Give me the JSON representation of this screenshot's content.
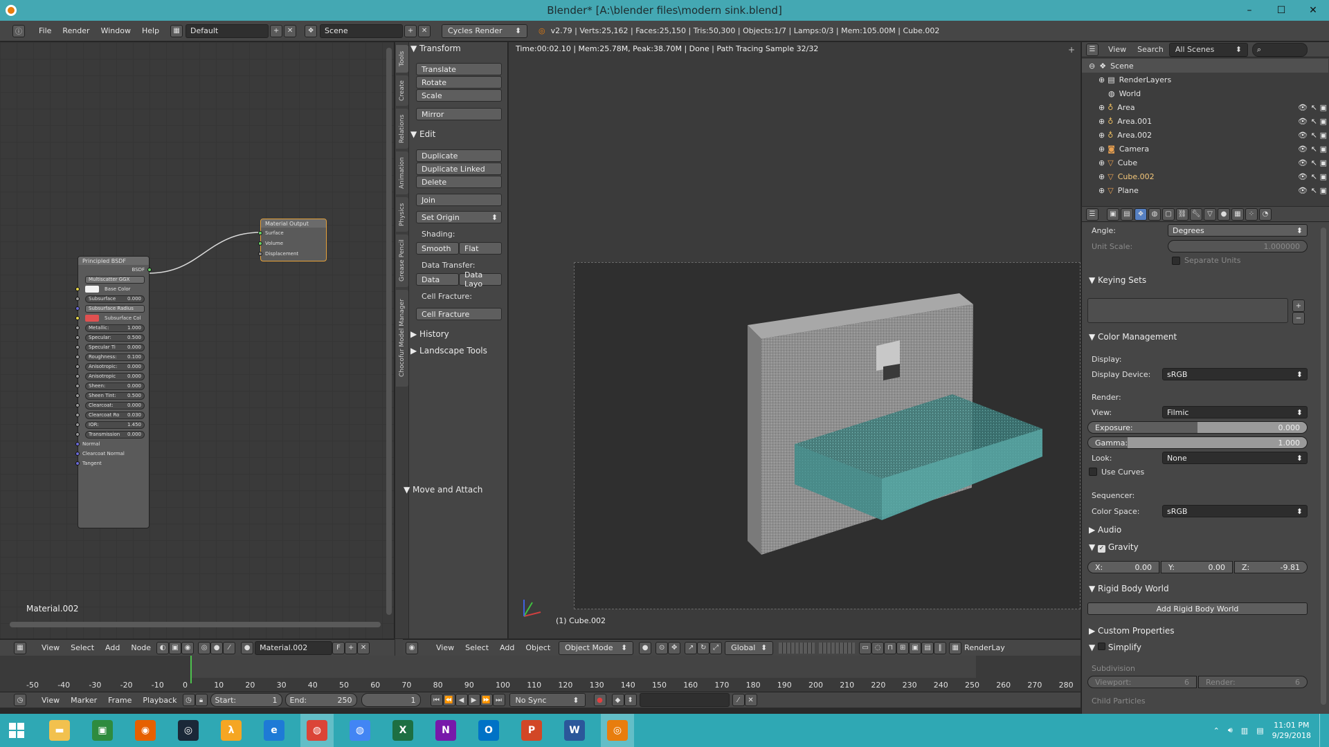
{
  "window": {
    "title": "Blender* [A:\\blender files\\modern sink.blend]",
    "controls": [
      "–",
      "☐",
      "✕"
    ]
  },
  "info_header": {
    "menus": [
      "File",
      "Render",
      "Window",
      "Help"
    ],
    "layout": "Default",
    "scene": "Scene",
    "engine": "Cycles Render",
    "stats": "v2.79 | Verts:25,162 | Faces:25,150 | Tris:50,300 | Objects:1/7 | Lamps:0/3 | Mem:105.00M | Cube.002"
  },
  "node_editor": {
    "material_label": "Material.002",
    "principled_node": {
      "title": "Principled BSDF",
      "output": "BSDF",
      "distribution": "Multiscatter GGX",
      "base_color": "Base Color",
      "subsurface": "Subsurface",
      "subsurface_value": "0.000",
      "subsurface_radius": "Subsurface Radius",
      "subsurface_color": "Subsurface Col",
      "params": [
        {
          "label": "Metallic:",
          "value": "1.000"
        },
        {
          "label": "Specular:",
          "value": "0.500"
        },
        {
          "label": "Specular Ti",
          "value": "0.000"
        },
        {
          "label": "Roughness:",
          "value": "0.100"
        },
        {
          "label": "Anisotropic:",
          "value": "0.000"
        },
        {
          "label": "Anisotropic",
          "value": "0.000"
        },
        {
          "label": "Sheen:",
          "value": "0.000"
        },
        {
          "label": "Sheen Tint:",
          "value": "0.500"
        },
        {
          "label": "Clearcoat:",
          "value": "0.000"
        },
        {
          "label": "Clearcoat Ro",
          "value": "0.030"
        },
        {
          "label": "IOR:",
          "value": "1.450"
        },
        {
          "label": "Transmission",
          "value": "0.000"
        }
      ],
      "inputs": [
        "Normal",
        "Clearcoat Normal",
        "Tangent"
      ]
    },
    "output_node": {
      "title": "Material Output",
      "inputs": [
        "Surface",
        "Volume",
        "Displacement"
      ]
    },
    "header": {
      "menus": [
        "View",
        "Select",
        "Add",
        "Node"
      ],
      "material": "Material.002",
      "fake_user": "F"
    }
  },
  "tool_shelf": {
    "tabs": [
      "Tools",
      "Create",
      "Relations",
      "Animation",
      "Physics",
      "Grease Pencil",
      "Chocofur Model Manager"
    ],
    "transform": {
      "title": "Transform",
      "buttons": [
        "Translate",
        "Rotate",
        "Scale",
        "Mirror"
      ]
    },
    "edit": {
      "title": "Edit",
      "buttons": [
        "Duplicate",
        "Duplicate Linked",
        "Delete",
        "Join"
      ],
      "set_origin": "Set Origin",
      "shading_label": "Shading:",
      "shading_buttons": [
        "Smooth",
        "Flat"
      ],
      "data_transfer_label": "Data Transfer:",
      "data_transfer_buttons": [
        "Data",
        "Data Layo"
      ],
      "cell_fracture_label": "Cell Fracture:",
      "cell_fracture_button": "Cell Fracture"
    },
    "collapsed": [
      "History",
      "Landscape Tools"
    ],
    "move_attach": "Move and Attach"
  },
  "viewport": {
    "render_status": "Time:00:02.10 | Mem:25.78M, Peak:38.70M | Done | Path Tracing Sample 32/32",
    "object_label": "(1) Cube.002",
    "header": {
      "menus": [
        "View",
        "Select",
        "Add",
        "Object"
      ],
      "mode": "Object Mode",
      "orientation": "Global",
      "render_layer": "RenderLay"
    }
  },
  "outliner": {
    "menus": [
      "View",
      "Search"
    ],
    "filter": "All Scenes",
    "items": [
      {
        "name": "Scene",
        "level": 0,
        "icon": "scene-icon"
      },
      {
        "name": "RenderLayers",
        "level": 1,
        "icon": "renderlayers-icon"
      },
      {
        "name": "World",
        "level": 1,
        "icon": "world-icon"
      },
      {
        "name": "Area",
        "level": 1,
        "icon": "lamp-icon"
      },
      {
        "name": "Area.001",
        "level": 1,
        "icon": "lamp-icon"
      },
      {
        "name": "Area.002",
        "level": 1,
        "icon": "lamp-icon"
      },
      {
        "name": "Camera",
        "level": 1,
        "icon": "camera-icon"
      },
      {
        "name": "Cube",
        "level": 1,
        "icon": "mesh-icon"
      },
      {
        "name": "Cube.002",
        "level": 1,
        "icon": "mesh-icon"
      },
      {
        "name": "Plane",
        "level": 1,
        "icon": "mesh-icon"
      }
    ]
  },
  "properties": {
    "units": {
      "angle_label": "Angle:",
      "angle_value": "Degrees",
      "unit_scale_label": "Unit Scale:",
      "unit_scale_value": "1.000000",
      "separate_units": "Separate Units"
    },
    "keying_sets": "Keying Sets",
    "color_management": {
      "title": "Color Management",
      "display_label": "Display:",
      "display_device_label": "Display Device:",
      "display_device": "sRGB",
      "render_label": "Render:",
      "view_label": "View:",
      "view": "Filmic",
      "exposure_label": "Exposure:",
      "exposure": "0.000",
      "gamma_label": "Gamma:",
      "gamma": "1.000",
      "look_label": "Look:",
      "look": "None",
      "use_curves": "Use Curves",
      "sequencer_label": "Sequencer:",
      "color_space_label": "Color Space:",
      "color_space": "sRGB"
    },
    "audio": "Audio",
    "gravity": {
      "title": "Gravity",
      "x_label": "X:",
      "x": "0.00",
      "y_label": "Y:",
      "y": "0.00",
      "z_label": "Z:",
      "z": "-9.81"
    },
    "rigid_body": {
      "title": "Rigid Body World",
      "button": "Add Rigid Body World"
    },
    "custom_props": "Custom Properties",
    "simplify": {
      "title": "Simplify",
      "subdivision_label": "Subdivision",
      "viewport_label": "Viewport:",
      "viewport": "6",
      "render_label": "Render:",
      "render": "6",
      "child_particles": "Child Particles"
    }
  },
  "timeline": {
    "ticks": [
      "-50",
      "-40",
      "-30",
      "-20",
      "-10",
      "0",
      "10",
      "20",
      "30",
      "40",
      "50",
      "60",
      "70",
      "80",
      "90",
      "100",
      "110",
      "120",
      "130",
      "140",
      "150",
      "160",
      "170",
      "180",
      "190",
      "200",
      "210",
      "220",
      "230",
      "240",
      "250",
      "260",
      "270",
      "280"
    ],
    "menus": [
      "View",
      "Marker",
      "Frame",
      "Playback"
    ],
    "start_label": "Start:",
    "start": "1",
    "end_label": "End:",
    "end": "250",
    "current": "1",
    "sync": "No Sync"
  },
  "taskbar": {
    "apps": [
      {
        "name": "file-explorer",
        "color": "#f2c14e",
        "glyph": "▬"
      },
      {
        "name": "store",
        "color": "#2e8b3e",
        "glyph": "▣"
      },
      {
        "name": "firefox",
        "color": "#e66000",
        "glyph": "◉"
      },
      {
        "name": "steam",
        "color": "#1b2838",
        "glyph": "◎"
      },
      {
        "name": "half-life",
        "color": "#f5a623",
        "glyph": "λ"
      },
      {
        "name": "edge",
        "color": "#1e7ad6",
        "glyph": "e"
      },
      {
        "name": "chrome",
        "color": "#db4437",
        "glyph": "◍"
      },
      {
        "name": "chrome-2",
        "color": "#4285f4",
        "glyph": "◍"
      },
      {
        "name": "excel",
        "color": "#1d6f42",
        "glyph": "X"
      },
      {
        "name": "onenote",
        "color": "#7719aa",
        "glyph": "N"
      },
      {
        "name": "outlook",
        "color": "#0072c6",
        "glyph": "O"
      },
      {
        "name": "powerpoint",
        "color": "#d24726",
        "glyph": "P"
      },
      {
        "name": "word",
        "color": "#2b579a",
        "glyph": "W"
      },
      {
        "name": "blender",
        "color": "#e87d0d",
        "glyph": "◎"
      }
    ],
    "time": "11:01 PM",
    "date": "9/29/2018"
  }
}
